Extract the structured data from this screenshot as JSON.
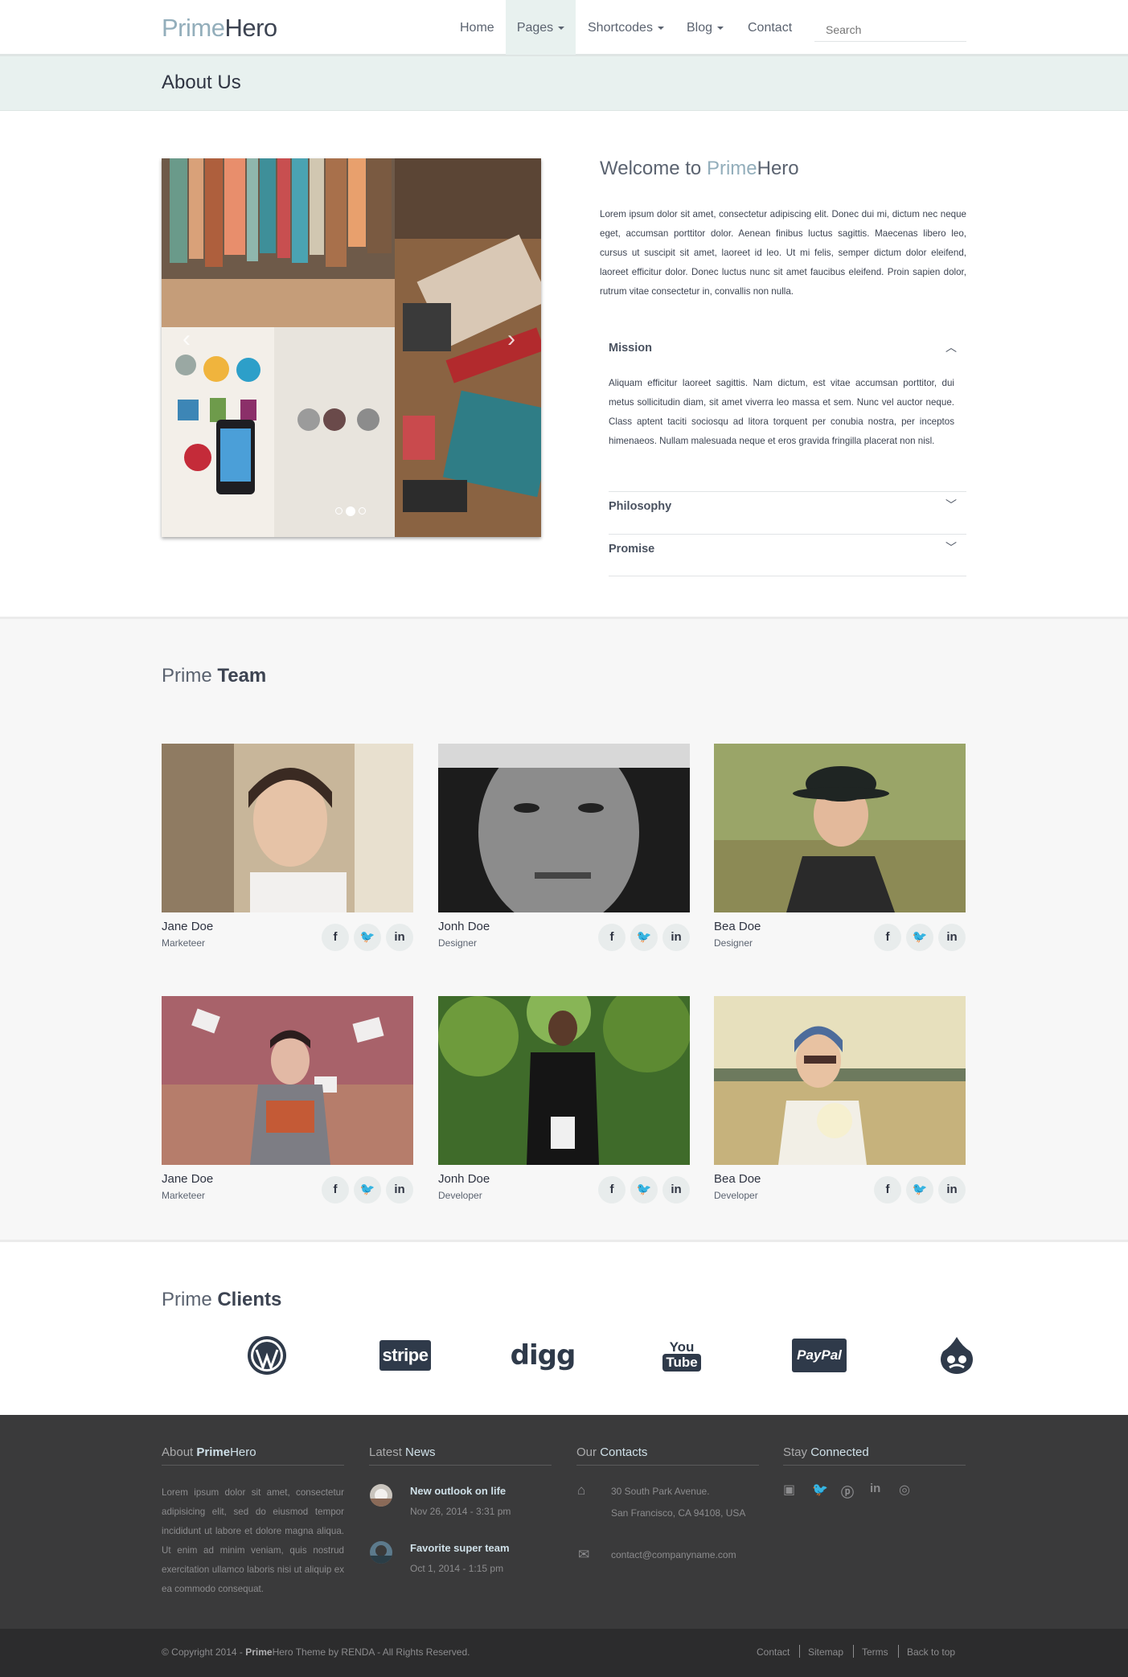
{
  "brand": {
    "prime": "Prime",
    "hero": "Hero"
  },
  "nav": {
    "items": [
      {
        "label": "Home"
      },
      {
        "label": "Pages"
      },
      {
        "label": "Shortcodes"
      },
      {
        "label": "Blog"
      },
      {
        "label": "Contact"
      }
    ],
    "search_placeholder": "Search"
  },
  "page_title": "About Us",
  "welcome": {
    "prefix": "Welcome to ",
    "prime": "Prime",
    "hero": "Hero",
    "text": "Lorem ipsum dolor sit amet, consectetur adipiscing elit. Donec dui mi, dictum nec neque eget, accumsan porttitor dolor. Aenean finibus luctus sagittis. Maecenas libero leo, cursus ut suscipit sit amet, laoreet id leo. Ut mi felis, semper dictum dolor eleifend, laoreet efficitur dolor. Donec luctus nunc sit amet faucibus eleifend. Proin sapien dolor, rutrum vitae consectetur in, convallis non nulla."
  },
  "accordion": {
    "mission_label": "Mission",
    "mission_text": "Aliquam efficitur laoreet sagittis. Nam dictum, est vitae accumsan porttitor, dui metus sollicitudin diam, sit amet viverra leo massa et sem. Nunc vel auctor neque. Class aptent taciti sociosqu ad litora torquent per conubia nostra, per inceptos himenaeos. Nullam malesuada neque et eros gravida fringilla placerat non nisl.",
    "philosophy_label": "Philosophy",
    "promise_label": "Promise"
  },
  "team": {
    "title_light": "Prime ",
    "title_bold": "Team",
    "members": [
      {
        "name": "Jane Doe",
        "role": "Marketeer"
      },
      {
        "name": "Jonh Doe",
        "role": "Designer"
      },
      {
        "name": "Bea Doe",
        "role": "Designer"
      },
      {
        "name": "Jane Doe",
        "role": "Marketeer"
      },
      {
        "name": "Jonh Doe",
        "role": "Developer"
      },
      {
        "name": "Bea Doe",
        "role": "Developer"
      }
    ],
    "social": {
      "facebook": "f",
      "twitter": "🐦",
      "linkedin": "in"
    }
  },
  "clients": {
    "title_light": "Prime ",
    "title_bold": "Clients",
    "logos": {
      "stripe": "stripe",
      "digg": "digg",
      "youtube_top": "You",
      "youtube_bottom": "Tube",
      "paypal": "PayPal"
    }
  },
  "footer": {
    "about_heading_light": "About ",
    "about_heading_prime": "Prime",
    "about_heading_hero": "Hero",
    "about_text": "Lorem ipsum dolor sit amet, consectetur adipisicing elit, sed do eiusmod tempor incididunt ut labore et dolore magna aliqua. Ut enim ad minim veniam, quis nostrud exercitation ullamco laboris nisi ut aliquip ex ea commodo consequat.",
    "news_heading_light": "Latest ",
    "news_heading_bold": "News",
    "news": [
      {
        "title": "New outlook on life",
        "date": "Nov 26, 2014 - 3:31 pm"
      },
      {
        "title": "Favorite super team",
        "date": "Oct 1, 2014 - 1:15 pm"
      }
    ],
    "contacts_heading_light": "Our ",
    "contacts_heading_bold": "Contacts",
    "address_line1": "30 South Park Avenue.",
    "address_line2": "San Francisco, CA 94108, USA",
    "email": "contact@companyname.com",
    "stay_heading_light": "Stay ",
    "stay_heading_bold": "Connected"
  },
  "bottom": {
    "copy_prefix": "© Copyright 2014 - ",
    "copy_prime": "Prime",
    "copy_suffix": "Hero Theme by RENDA - All Rights Reserved.",
    "links": [
      "Contact",
      "Sitemap",
      "Terms",
      "Back to top"
    ]
  },
  "colors": {
    "accent": "#93aebb",
    "dark": "#3d4452",
    "titlebar": "#e8f1ef",
    "footer": "#3a3a3b"
  }
}
